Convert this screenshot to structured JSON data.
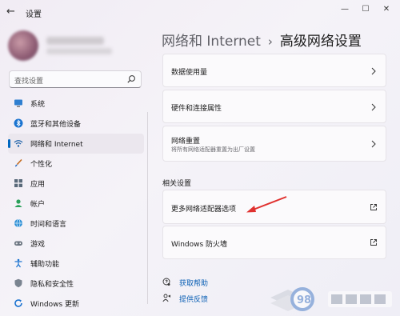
{
  "window": {
    "title": "设置",
    "controls": [
      "—",
      "☐",
      "✕"
    ]
  },
  "sidebar": {
    "search_placeholder": "查找设置",
    "items": [
      {
        "label": "系统",
        "icon": "monitor-icon",
        "active": false
      },
      {
        "label": "蓝牙和其他设备",
        "icon": "bluetooth-icon",
        "active": false
      },
      {
        "label": "网络和 Internet",
        "icon": "wifi-icon",
        "active": true
      },
      {
        "label": "个性化",
        "icon": "brush-icon",
        "active": false
      },
      {
        "label": "应用",
        "icon": "apps-icon",
        "active": false
      },
      {
        "label": "帐户",
        "icon": "account-icon",
        "active": false
      },
      {
        "label": "时间和语言",
        "icon": "globe-icon",
        "active": false
      },
      {
        "label": "游戏",
        "icon": "gamepad-icon",
        "active": false
      },
      {
        "label": "辅助功能",
        "icon": "accessibility-icon",
        "active": false
      },
      {
        "label": "隐私和安全性",
        "icon": "shield-icon",
        "active": false
      },
      {
        "label": "Windows 更新",
        "icon": "update-icon",
        "active": false
      }
    ]
  },
  "header": {
    "breadcrumb_parent": "网络和 Internet",
    "breadcrumb_separator": "›",
    "breadcrumb_current": "高级网络设置"
  },
  "main": {
    "cards": [
      {
        "title": "数据使用量",
        "subtitle": ""
      },
      {
        "title": "硬件和连接属性",
        "subtitle": ""
      },
      {
        "title": "网络重置",
        "subtitle": "将所有网络适配器重置为出厂设置"
      }
    ],
    "related_title": "相关设置",
    "related": [
      {
        "title": "更多网络适配器选项"
      },
      {
        "title": "Windows 防火墙"
      }
    ],
    "help_links": [
      {
        "label": "获取帮助",
        "icon": "help-icon"
      },
      {
        "label": "提供反馈",
        "icon": "feedback-icon"
      }
    ]
  },
  "colors": {
    "accent": "#0067c0",
    "link": "#0a5fb4",
    "annotation_arrow": "#e0312f"
  }
}
